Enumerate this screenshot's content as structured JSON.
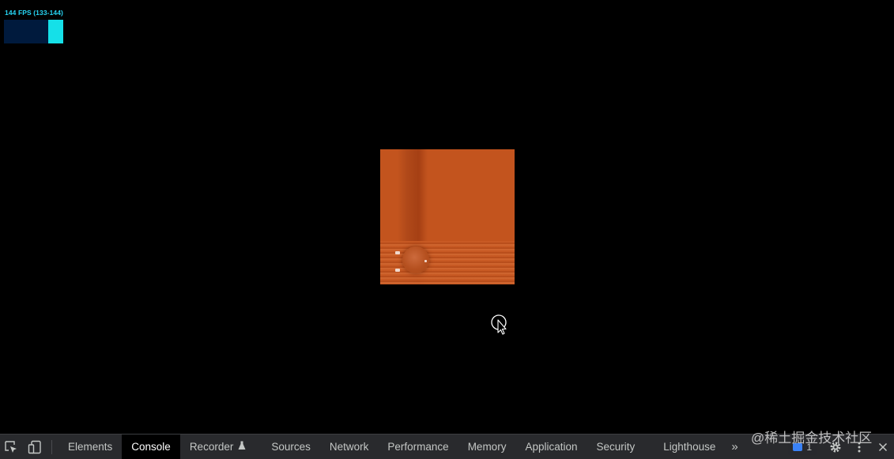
{
  "fps_meter": {
    "label": "144 FPS (133-144)",
    "color": "#27d6f5"
  },
  "devtools": {
    "tabs": [
      {
        "label": "Elements",
        "active": false
      },
      {
        "label": "Console",
        "active": true
      },
      {
        "label": "Recorder",
        "active": false
      },
      {
        "label": "Sources",
        "active": false
      },
      {
        "label": "Network",
        "active": false
      },
      {
        "label": "Performance",
        "active": false
      },
      {
        "label": "Memory",
        "active": false
      },
      {
        "label": "Application",
        "active": false
      },
      {
        "label": "Security",
        "active": false
      },
      {
        "label": "Lighthouse",
        "active": false
      }
    ],
    "more_tabs_glyph": "»",
    "issues_count": "1",
    "icons": {
      "inspect": "inspect-element-icon",
      "device": "device-toolbar-icon",
      "recorder_badge": "flask-icon",
      "issues": "chat-icon",
      "settings": "gear-icon",
      "menu": "kebab-menu-icon",
      "close": "close-icon"
    }
  },
  "watermark": {
    "text": "@稀土掘金技术社区"
  },
  "colors": {
    "canvas_orange": "#c3541e",
    "devtools_bg": "#292a2d",
    "active_tab_bg": "#000000"
  }
}
